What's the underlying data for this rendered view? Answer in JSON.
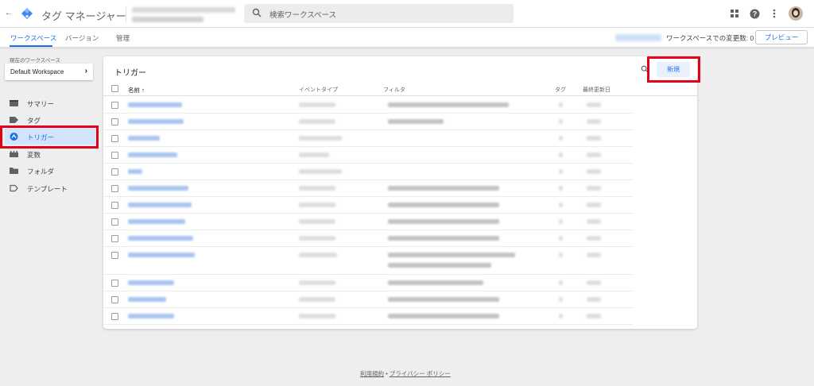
{
  "app": {
    "title": "タグ マネージャー"
  },
  "search": {
    "placeholder": "検索ワークスペース"
  },
  "tabs": [
    {
      "label": "ワークスペース",
      "active": true
    },
    {
      "label": "バージョン",
      "active": false
    },
    {
      "label": "管理",
      "active": false
    }
  ],
  "workspace_changes": "ワークスペースでの変更数: 0",
  "preview_label": "プレビュー",
  "sidebar": {
    "current_label": "現在のワークスペース",
    "workspace_name": "Default Workspace",
    "items": [
      {
        "label": "サマリー",
        "icon": "summary-icon",
        "active": false
      },
      {
        "label": "タグ",
        "icon": "tag-icon",
        "active": false
      },
      {
        "label": "トリガー",
        "icon": "trigger-icon",
        "active": true
      },
      {
        "label": "変数",
        "icon": "variable-icon",
        "active": false
      },
      {
        "label": "フォルダ",
        "icon": "folder-icon",
        "active": false
      },
      {
        "label": "テンプレート",
        "icon": "template-icon",
        "active": false
      }
    ]
  },
  "main": {
    "title": "トリガー",
    "new_button": "新規",
    "columns": [
      "名前 ↑",
      "イベントタイプ",
      "フィルタ",
      "タグ",
      "最終更新日"
    ]
  },
  "footer": {
    "terms": "利用規約",
    "separator": " • ",
    "privacy": "プライバシー ポリシー"
  },
  "colors": {
    "accent": "#1a73e8",
    "highlight": "#e3001b",
    "active_nav_bg": "#d2e3fc"
  }
}
